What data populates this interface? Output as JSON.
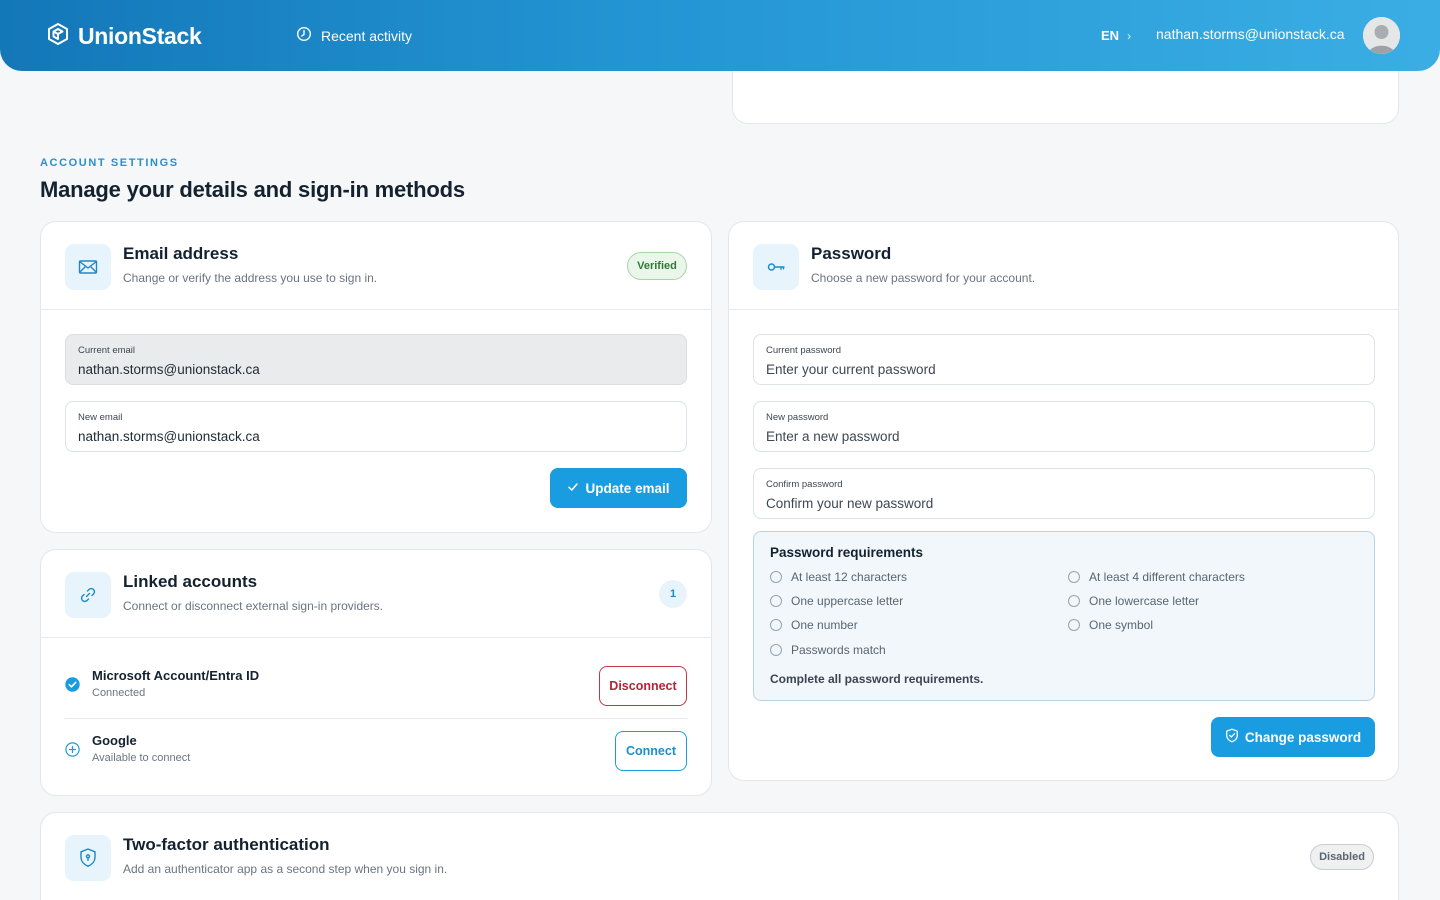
{
  "header": {
    "brand": "UnionStack",
    "recent_activity": "Recent activity",
    "language": "EN",
    "user_email": "nathan.storms@unionstack.ca"
  },
  "page": {
    "eyebrow": "ACCOUNT SETTINGS",
    "title": "Manage your details and sign-in methods"
  },
  "email_card": {
    "title": "Email address",
    "subtitle": "Change or verify the address you use to sign in.",
    "badge": "Verified",
    "current_label": "Current email",
    "current_value": "nathan.storms@unionstack.ca",
    "new_label": "New email",
    "new_value": "nathan.storms@unionstack.ca",
    "button": "Update email"
  },
  "linked_card": {
    "title": "Linked accounts",
    "subtitle": "Connect or disconnect external sign-in providers.",
    "count": "1",
    "accounts": [
      {
        "name": "Microsoft Account/Entra ID",
        "status": "Connected",
        "action": "Disconnect"
      },
      {
        "name": "Google",
        "status": "Available to connect",
        "action": "Connect"
      }
    ]
  },
  "password_card": {
    "title": "Password",
    "subtitle": "Choose a new password for your account.",
    "current_label": "Current password",
    "current_placeholder": "Enter your current password",
    "new_label": "New password",
    "new_placeholder": "Enter a new password",
    "confirm_label": "Confirm password",
    "confirm_placeholder": "Confirm your new password",
    "requirements_title": "Password requirements",
    "requirements": [
      "At least 12 characters",
      "At least 4 different characters",
      "One uppercase letter",
      "One lowercase letter",
      "One number",
      "One symbol",
      "Passwords match"
    ],
    "requirements_note": "Complete all password requirements.",
    "button": "Change password"
  },
  "twofa_card": {
    "title": "Two-factor authentication",
    "subtitle": "Add an authenticator app as a second step when you sign in.",
    "badge": "Disabled"
  },
  "colors": {
    "primary": "#1a9de0",
    "header_start": "#1377b8",
    "header_end": "#3aaee4",
    "danger": "#c6364a",
    "success": "#2f7a35"
  },
  "icons": {
    "brand": "hexagon-logo-icon",
    "activity": "clock-icon",
    "email": "envelope-icon",
    "link": "link-icon",
    "password": "key-icon",
    "twofa": "shield-icon",
    "connected": "check-circle-icon",
    "connect": "plus-circle-icon"
  }
}
